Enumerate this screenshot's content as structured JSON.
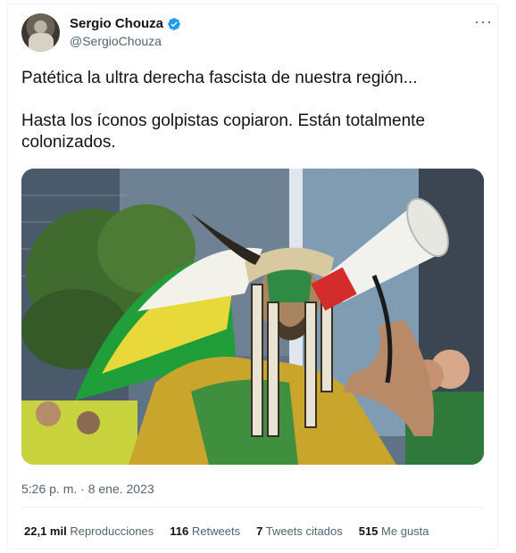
{
  "author": {
    "display_name": "Sergio Chouza",
    "handle": "@SergioChouza"
  },
  "tweet": {
    "text_line_1": "Patética la ultra derecha fascista de nuestra región...",
    "text_line_2": "Hasta los íconos golpistas copiaron. Están totalmente colonizados.",
    "timestamp": "5:26 p. m. · 8 ene. 2023"
  },
  "stats": {
    "views_count": "22,1 mil",
    "views_label": "Reproducciones",
    "retweets_count": "116",
    "retweets_label": "Retweets",
    "quotes_count": "7",
    "quotes_label": "Tweets citados",
    "likes_count": "515",
    "likes_label": "Me gusta"
  },
  "icons": {
    "verified": "verified-badge-icon",
    "more": "more-options-icon"
  },
  "colors": {
    "verified_blue": "#1d9bf0",
    "text_primary": "#0f1419",
    "text_secondary": "#536471"
  }
}
